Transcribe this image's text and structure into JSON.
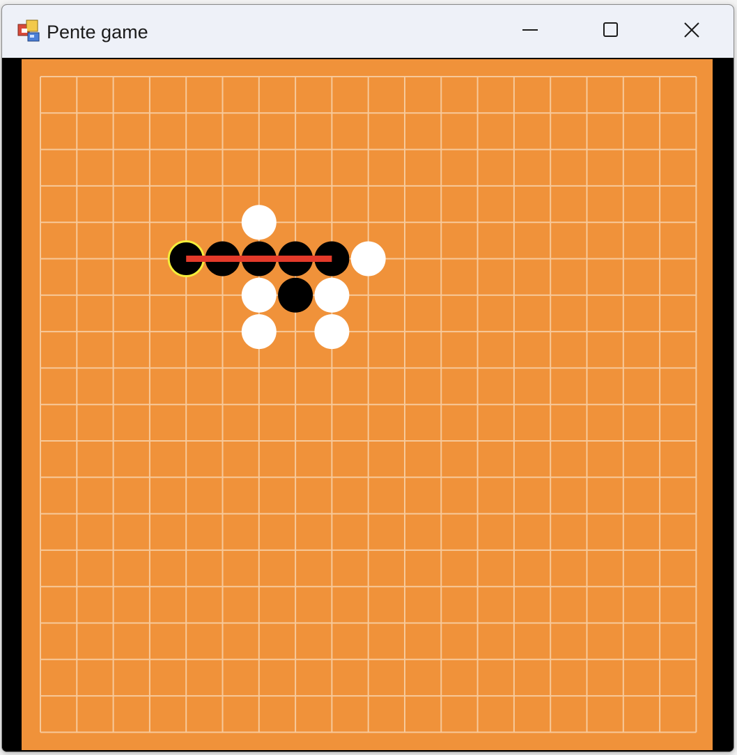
{
  "window": {
    "title": "Pente game",
    "icon": "winforms-app-icon",
    "controls": {
      "minimize_icon": "minimize-icon",
      "maximize_icon": "maximize-icon",
      "close_icon": "close-icon"
    }
  },
  "board": {
    "colors": {
      "board": "#f0923a",
      "grid": "#f7c99a",
      "black_stone": "#000000",
      "white_stone": "#ffffff",
      "last_move_ring": "#f5ee3a",
      "winning_line": "#e43a2a"
    },
    "stones": [
      {
        "col": 6,
        "row": 4,
        "color": "white"
      },
      {
        "col": 4,
        "row": 5,
        "color": "black",
        "last_move": true
      },
      {
        "col": 5,
        "row": 5,
        "color": "black"
      },
      {
        "col": 6,
        "row": 5,
        "color": "black"
      },
      {
        "col": 7,
        "row": 5,
        "color": "black"
      },
      {
        "col": 8,
        "row": 5,
        "color": "black"
      },
      {
        "col": 9,
        "row": 5,
        "color": "white"
      },
      {
        "col": 6,
        "row": 6,
        "color": "white"
      },
      {
        "col": 7,
        "row": 6,
        "color": "black"
      },
      {
        "col": 8,
        "row": 6,
        "color": "white"
      },
      {
        "col": 6,
        "row": 7,
        "color": "white"
      },
      {
        "col": 8,
        "row": 7,
        "color": "white"
      }
    ],
    "winning_line": {
      "from": {
        "col": 4,
        "row": 5
      },
      "to": {
        "col": 8,
        "row": 5
      }
    }
  }
}
